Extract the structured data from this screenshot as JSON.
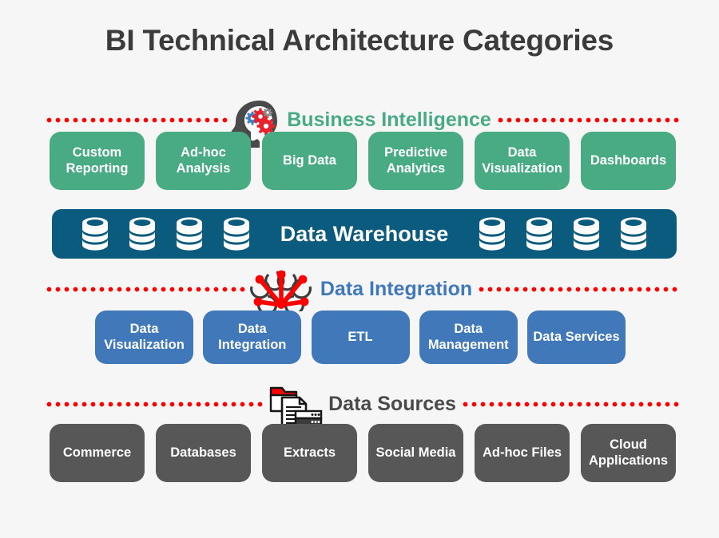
{
  "page": {
    "title": "BI Technical Architecture Categories",
    "background_color": "#f6f6f6",
    "title_color": "#3b3b3b"
  },
  "colors": {
    "business_intelligence": "#48ab83",
    "data_warehouse": "#0a5b7d",
    "data_integration": "#4078b9",
    "data_sources": "#575757",
    "dotted_line": "#ff0000",
    "icon_accent": "#ff0000"
  },
  "layers": [
    {
      "id": "business-intelligence",
      "label": "Business Intelligence",
      "label_color": "#48ab83",
      "icon": "head-gears-icon",
      "box_color": "#48ab83",
      "boxes": [
        {
          "label": "Custom Reporting"
        },
        {
          "label": "Ad-hoc Analysis"
        },
        {
          "label": "Big Data"
        },
        {
          "label": "Predictive Analytics"
        },
        {
          "label": "Data Visualization"
        },
        {
          "label": "Dashboards"
        }
      ]
    },
    {
      "id": "data-warehouse",
      "label": "Data Warehouse",
      "label_color": "#ffffff",
      "bar_color": "#0a5b7d",
      "icon": "database-cylinder-icon",
      "databases_left": 4,
      "databases_right": 4
    },
    {
      "id": "data-integration",
      "label": "Data Integration",
      "label_color": "#4078b9",
      "icon": "network-hub-icon",
      "box_color": "#4078b9",
      "boxes": [
        {
          "label": "Data Visualization"
        },
        {
          "label": "Data Integration"
        },
        {
          "label": "ETL"
        },
        {
          "label": "Data Management"
        },
        {
          "label": "Data Services"
        }
      ]
    },
    {
      "id": "data-sources",
      "label": "Data Sources",
      "label_color": "#4a4a4a",
      "icon": "folder-document-server-icon",
      "box_color": "#575757",
      "boxes": [
        {
          "label": "Commerce"
        },
        {
          "label": "Databases"
        },
        {
          "label": "Extracts"
        },
        {
          "label": "Social Media"
        },
        {
          "label": "Ad-hoc Files"
        },
        {
          "label": "Cloud Applications"
        }
      ]
    }
  ]
}
